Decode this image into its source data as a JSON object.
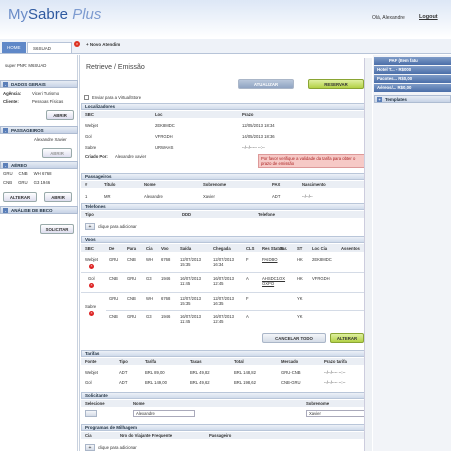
{
  "header": {
    "logo_prefix": "My",
    "logo_brand": "Sabre",
    "logo_suffix": "Plus",
    "user": "Olá, Alexandre",
    "logout": "Logout"
  },
  "tabs": {
    "home": "HOME",
    "user": "S6SUAD",
    "new": "+ Novo Atendim"
  },
  "left": {
    "super_pnr_label": "super PNR:",
    "super_pnr_value": "M6SUAD",
    "dados_title": "DADOS GERAIS",
    "agencia_label": "Agência:",
    "agencia_value": "Viceri Turismo",
    "cliente_label": "Cliente:",
    "cliente_value": "Pessoas Físicas",
    "abrir": "ABRIR",
    "passageiros_title": "PASSAGEIROS",
    "passageiro": "Alexandre Xavier",
    "bpeslab": "ABRIR",
    "aereo_title": "AÉREO",
    "aereo_rows": [
      [
        "GRU",
        "CNB",
        "WH 6768"
      ],
      [
        "CNB",
        "GRU",
        "G3 1946"
      ]
    ],
    "alterar": "ALTERAR",
    "abrir2": "ABRIR",
    "analise_title": "ANÁLISE DE BECO",
    "solicitar": "SOLICITAR"
  },
  "main": {
    "title": "Retrieve / Emissão",
    "atualizar": "ATUALIZAR",
    "reservar": "RESERVAR",
    "envio_label": "Enviar para a Virtual/Store",
    "localizadores": {
      "title": "Localizadores",
      "cols": [
        "SBC",
        "Loc",
        "Prazo"
      ],
      "rows": [
        [
          "Webjet",
          "2EK8MDC",
          "12/05/2013 18:34"
        ],
        [
          "Gol",
          "VFRGDH",
          "14/05/2013 18:36"
        ],
        [
          "Sabre",
          "URWAHS",
          "--/--/-----  --:--"
        ]
      ],
      "criado_label": "Criado Por:",
      "criado_value": "Alexandre xavier",
      "aviso": "Por favor verifique a validade da tarifa para obter o prazo de emissão"
    },
    "passageiros": {
      "title": "Passageiros",
      "cols": [
        "#",
        "Título",
        "Nome",
        "Sobrenome",
        "PAX",
        "Nascimento"
      ],
      "rows": [
        [
          "1",
          "MR",
          "Alexandre",
          "Xavier",
          "ADT",
          "--/--/--"
        ]
      ]
    },
    "telefones": {
      "title": "Telefones",
      "cols": [
        "Tipo",
        "DDD",
        "Telefone"
      ],
      "add": "clique para adicionar"
    },
    "voos": {
      "title": "Voos",
      "cols": [
        "SBC",
        "De",
        "Para",
        "Cia",
        "Voo",
        "Saída",
        "Chegada",
        "CLS",
        "Res Status",
        "Tar.",
        "ST",
        "Loc Cia",
        "Assentos"
      ],
      "rows": [
        [
          "Webjet",
          "GRU",
          "CNB",
          "WH",
          "6768",
          "12/07/2013 15:35",
          "12/07/2013 16:34",
          "F",
          "PAIDBO",
          "HK",
          "2EK8MDC",
          ""
        ],
        [
          "Gol",
          "CNB",
          "GRU",
          "G3",
          "1946",
          "16/07/2013 11:45",
          "16/07/2013 12:45",
          "A",
          "AHSDC1OX OXPO",
          "HK",
          "VFRGDH",
          ""
        ],
        [
          "Sabre",
          "GRU",
          "CNB",
          "WH",
          "6768",
          "12/07/2013 15:35",
          "12/07/2013 16:35",
          "F",
          "",
          "YK",
          "",
          ""
        ],
        [
          "",
          "CNB",
          "GRU",
          "G3",
          "1946",
          "16/07/2013 11:45",
          "16/07/2013 12:45",
          "A",
          "",
          "YK",
          "",
          ""
        ]
      ],
      "cancelar": "CANCELAR TODO",
      "alterar": "ALTERAR"
    },
    "tarifas": {
      "title": "Tarifas",
      "cols": [
        "Fonte",
        "Tipo",
        "Tarifa",
        "Taxas",
        "Total",
        "Mercado",
        "Prazo tarifa"
      ],
      "rows": [
        [
          "Webjet",
          "ADT",
          "BRL 89,00",
          "BRL 49,82",
          "BRL 148,82",
          "GRU-CNB",
          "--/--/---- --:--"
        ],
        [
          "Gol",
          "ADT",
          "BRL 149,00",
          "BRL 49,62",
          "BRL 198,62",
          "CNB-GRU",
          "--/--/---- --:--"
        ]
      ]
    },
    "solicitante": {
      "title": "Solicitante",
      "cols": [
        "Selecione",
        "Nome",
        "Sobrenome"
      ],
      "nome": "Alexandre",
      "sobrenome": "Xavier"
    },
    "milhagem": {
      "title": "Programas de Milhagem",
      "cols": [
        "Cia",
        "Nro do Viajante Frequente",
        "Passageiro"
      ],
      "add": "clique para adicionar"
    }
  },
  "right": {
    "items": [
      {
        "label": "PAF   (Item fatu"
      },
      {
        "label": "Hotel T...   -   R$000"
      },
      {
        "label": "Pacotes...   R$0,00"
      },
      {
        "label": "Aéreos/...   R$0,00"
      },
      {
        "label": "Templates"
      }
    ]
  }
}
